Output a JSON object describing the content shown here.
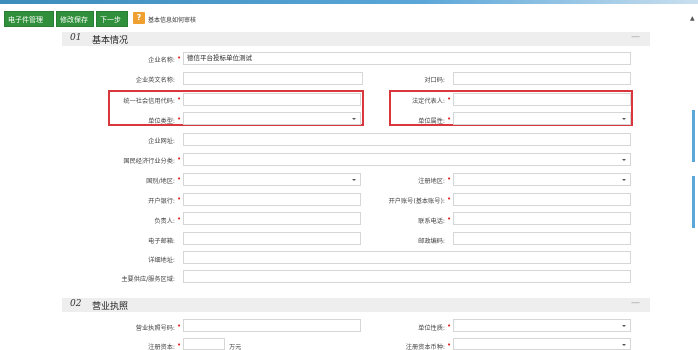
{
  "toolbar": {
    "buttons": [
      "电子件管理",
      "修改保存",
      "下一步"
    ],
    "help_icon": "question-icon",
    "help_link": "基本信息如何审核"
  },
  "section1": {
    "num": "01",
    "title": "基本情况",
    "collapse": "—",
    "fields": {
      "company_name": {
        "label": "企业名称:",
        "value": "德信平台投标单位测试"
      },
      "company_en": {
        "label": "企业英文名称:",
        "value": ""
      },
      "org_code": {
        "label": "对口码:",
        "value": ""
      },
      "credit_code": {
        "label": "统一社会信用代码:",
        "value": ""
      },
      "legal_rep": {
        "label": "法定代表人:",
        "value": ""
      },
      "unit_type": {
        "label": "单位类型:",
        "value": ""
      },
      "unit_attr": {
        "label": "单位属性:",
        "value": ""
      },
      "website": {
        "label": "企业网址:",
        "value": ""
      },
      "industry": {
        "label": "国民经济行业分类:",
        "value": ""
      },
      "country": {
        "label": "国别/地区:",
        "value": ""
      },
      "reg_area": {
        "label": "注册地区:",
        "value": ""
      },
      "bank": {
        "label": "开户银行:",
        "value": ""
      },
      "account": {
        "label": "开户账号(基本账号):",
        "value": ""
      },
      "manager": {
        "label": "负责人:",
        "value": ""
      },
      "phone": {
        "label": "联系电话:",
        "value": ""
      },
      "email": {
        "label": "电子邮箱:",
        "value": ""
      },
      "postcode": {
        "label": "邮政编码:",
        "value": ""
      },
      "address": {
        "label": "详细地址:",
        "value": ""
      },
      "service_area": {
        "label": "主要供应/服务区域:",
        "value": ""
      }
    }
  },
  "section2": {
    "num": "02",
    "title": "营业执照",
    "collapse": "—",
    "fields": {
      "license_no": {
        "label": "营业执照号码:",
        "value": ""
      },
      "unit_nature": {
        "label": "单位性质:",
        "value": ""
      },
      "reg_capital": {
        "label": "注册资本:",
        "value": "",
        "unit": "万元"
      },
      "capital_currency": {
        "label": "注册资本币种:",
        "value": ""
      }
    }
  }
}
